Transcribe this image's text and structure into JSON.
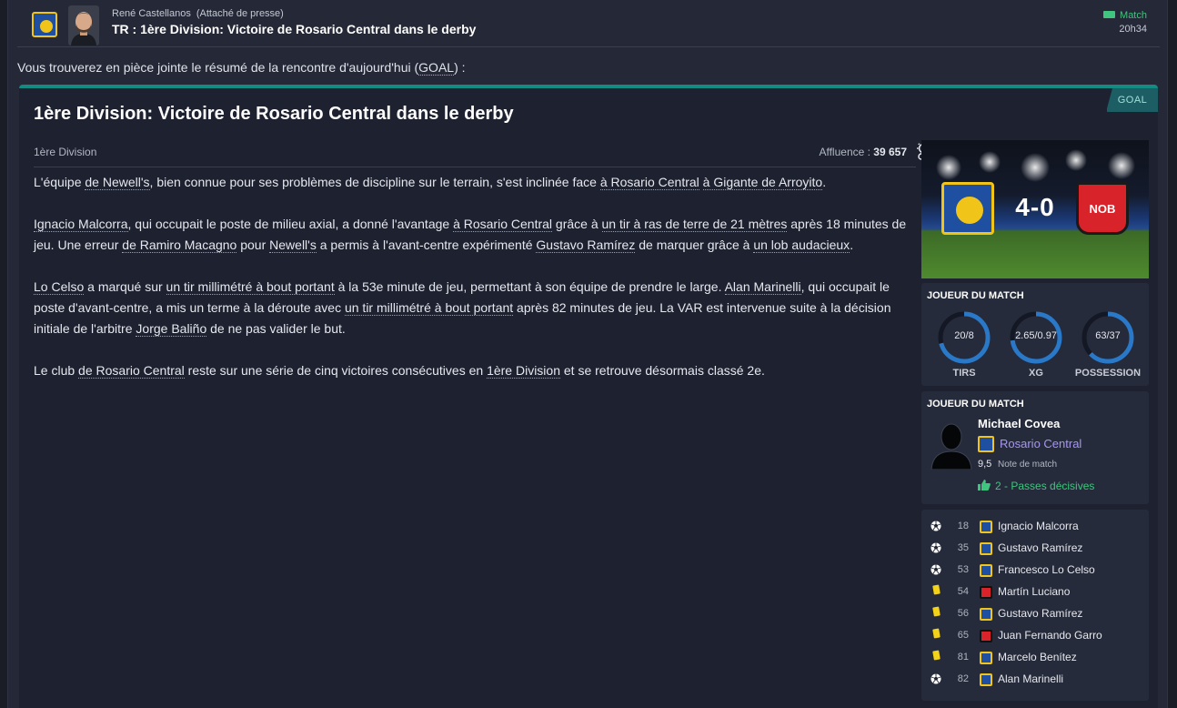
{
  "header": {
    "sender_name": "René Castellanos",
    "sender_role": "(Attaché de presse)",
    "subject": "TR : 1ère Division: Victoire de Rosario Central dans le derby",
    "category": "Match",
    "time": "20h34"
  },
  "intro": {
    "text_before": "Vous trouverez en pièce jointe le résumé de la rencontre d'aujourd'hui (",
    "link": "GOAL",
    "text_after": ") :"
  },
  "card": {
    "badge": "GOAL",
    "headline": "1ère Division: Victoire de Rosario Central dans le derby",
    "competition": "1ère Division",
    "attendance_label": "Affluence :",
    "attendance_value": "39 657",
    "weather_icon": "partly-cloudy-icon"
  },
  "article": {
    "p1": [
      "L'équipe ",
      "de Newell's",
      ", bien connue pour ses problèmes de discipline sur le terrain, s'est inclinée face ",
      "à Rosario Central",
      " ",
      "à Gigante de Arroyito",
      "."
    ],
    "p2": [
      "Ignacio Malcorra",
      ", qui occupait le poste de milieu axial, a donné l'avantage ",
      "à Rosario Central",
      " grâce à ",
      "un tir à ras de terre de 21 mètres",
      " après 18 minutes de jeu. Une erreur ",
      "de Ramiro Macagno",
      " pour ",
      "Newell's",
      " a permis à l'avant-centre expérimenté ",
      "Gustavo Ramírez",
      " de marquer grâce à ",
      "un lob audacieux",
      "."
    ],
    "p3": [
      "Lo Celso",
      " a marqué sur ",
      "un tir millimétré à bout portant",
      " à la 53e minute de jeu, permettant à son équipe de prendre le large. ",
      "Alan Marinelli",
      ", qui occupait le poste d'avant-centre, a mis un terme à la déroute avec ",
      "un tir millimétré à bout portant",
      " après 82 minutes de jeu. La VAR est intervenue suite à la décision initiale de l'arbitre ",
      "Jorge Baliño",
      " de ne pas valider le but."
    ],
    "p4": [
      "Le club ",
      "de Rosario Central",
      " reste sur une série de cinq victoires consécutives en ",
      "1ère Division",
      " et se retrouve désormais classé 2e."
    ]
  },
  "scoreboard": {
    "score": "4-0",
    "home_badge": "rosario-central-badge",
    "away_badge_text": "NOB"
  },
  "stats_panel": {
    "title": "JOUEUR DU MATCH",
    "items": [
      {
        "label": "TIRS",
        "value": "20/8",
        "home_share": 0.71
      },
      {
        "label": "XG",
        "value": "2.65/0.97",
        "home_share": 0.73
      },
      {
        "label": "POSSESSION",
        "value": "63/37",
        "home_share": 0.63
      }
    ],
    "ring_color": "#2a78c8"
  },
  "potm": {
    "title": "JOUEUR DU MATCH",
    "name": "Michael Covea",
    "club": "Rosario Central",
    "rating": "9,5",
    "rating_label": "Note de match",
    "assists": "2 - Passes décisives"
  },
  "events": [
    {
      "type": "goal",
      "minute": "18",
      "team": "home",
      "player": "Ignacio Malcorra"
    },
    {
      "type": "goal",
      "minute": "35",
      "team": "home",
      "player": "Gustavo Ramírez"
    },
    {
      "type": "goal",
      "minute": "53",
      "team": "home",
      "player": "Francesco Lo Celso"
    },
    {
      "type": "yellow",
      "minute": "54",
      "team": "away",
      "player": "Martín Luciano"
    },
    {
      "type": "yellow",
      "minute": "56",
      "team": "home",
      "player": "Gustavo Ramírez"
    },
    {
      "type": "yellow",
      "minute": "65",
      "team": "away",
      "player": "Juan Fernando Garro"
    },
    {
      "type": "yellow",
      "minute": "81",
      "team": "home",
      "player": "Marcelo Benítez"
    },
    {
      "type": "goal",
      "minute": "82",
      "team": "home",
      "player": "Alan Marinelli"
    }
  ]
}
